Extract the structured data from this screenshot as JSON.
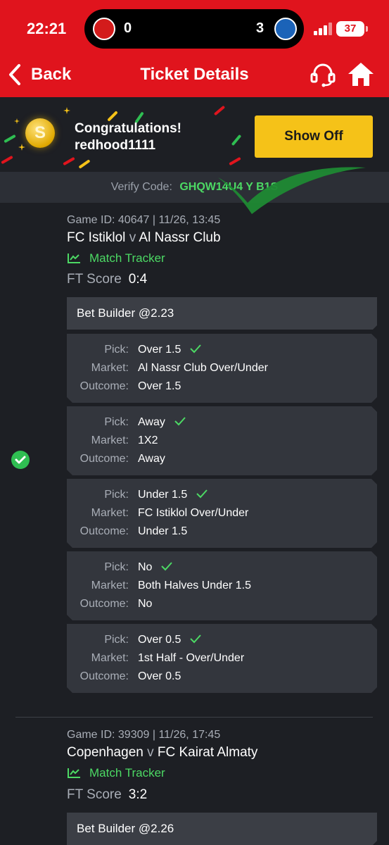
{
  "status_bar": {
    "time": "22:21",
    "home_score": "0",
    "away_score": "3",
    "battery": "37"
  },
  "nav": {
    "back_label": "Back",
    "title": "Ticket Details"
  },
  "banner": {
    "title": "Congratulations!",
    "username": "redhood1111",
    "show_off_label": "Show Off",
    "coin_symbol": "S"
  },
  "verify": {
    "label": "Verify Code:",
    "code": "GHQW14U4  Y  B1S"
  },
  "games": [
    {
      "meta": "Game ID: 40647 | 11/26, 13:45",
      "home": "FC Istiklol",
      "vs": "v",
      "away": "Al Nassr Club",
      "tracker_label": "Match Tracker",
      "ft_label": "FT Score",
      "ft_value": "0:4",
      "builder": "Bet Builder @2.23",
      "picks": [
        {
          "pick": "Over 1.5",
          "market": "Al Nassr Club Over/Under",
          "outcome": "Over 1.5"
        },
        {
          "pick": "Away",
          "market": "1X2",
          "outcome": "Away"
        },
        {
          "pick": "Under 1.5",
          "market": "FC Istiklol Over/Under",
          "outcome": "Under 1.5"
        },
        {
          "pick": "No",
          "market": "Both Halves Under 1.5",
          "outcome": "No"
        },
        {
          "pick": "Over 0.5",
          "market": "1st Half - Over/Under",
          "outcome": "Over 0.5"
        }
      ]
    },
    {
      "meta": "Game ID: 39309 | 11/26, 17:45",
      "home": "Copenhagen",
      "vs": "v",
      "away": "FC Kairat Almaty",
      "tracker_label": "Match Tracker",
      "ft_label": "FT Score",
      "ft_value": "3:2",
      "builder": "Bet Builder @2.26"
    }
  ],
  "labels": {
    "pick": "Pick:",
    "market": "Market:",
    "outcome": "Outcome:"
  },
  "colors": {
    "header_red": "#e0141d",
    "accent_green": "#4cd964",
    "button_yellow": "#f5c218",
    "background": "#1d1f24"
  }
}
